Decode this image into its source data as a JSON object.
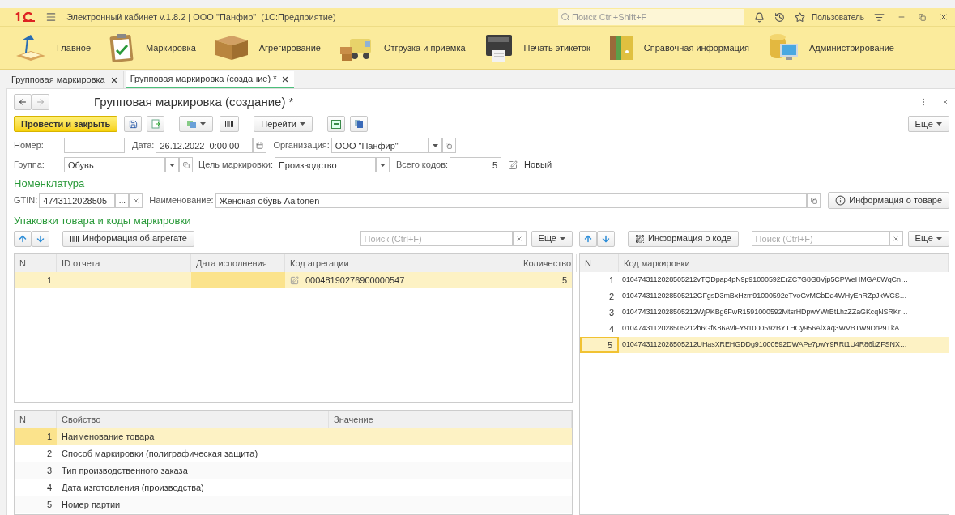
{
  "window": {
    "title": "Электронный кабинет v.1.8.2 | ООО \"Панфир\"  (1С:Предприятие)",
    "search_placeholder": "Поиск Ctrl+Shift+F",
    "user": "Пользователь"
  },
  "sections": [
    {
      "label": "Главное",
      "kind": "lamp"
    },
    {
      "label": "Маркировка",
      "kind": "clipboard"
    },
    {
      "label": "Агрегирование",
      "kind": "box"
    },
    {
      "label": "Отгрузка и приёмка",
      "kind": "truck"
    },
    {
      "label": "Печать этикеток",
      "kind": "printer"
    },
    {
      "label": "Справочная информация",
      "kind": "folders"
    },
    {
      "label": "Администрирование",
      "kind": "database"
    }
  ],
  "tabs": [
    {
      "label": "Групповая маркировка",
      "selected": false
    },
    {
      "label": "Групповая маркировка (создание) *",
      "selected": true
    }
  ],
  "form": {
    "title": "Групповая маркировка (создание) *",
    "post_button": "Провести и закрыть",
    "goto_button": "Перейти",
    "more_button": "Еще",
    "number": {
      "label": "Номер:"
    },
    "date": {
      "label": "Дата:",
      "value": "26.12.2022  0:00:00"
    },
    "organization": {
      "label": "Организация:",
      "value": "ООО \"Панфир\""
    },
    "group": {
      "label": "Группа:",
      "value": "Обувь"
    },
    "purpose": {
      "label": "Цель маркировки:",
      "value": "Производство"
    },
    "total": {
      "label": "Всего кодов:",
      "value": "5"
    },
    "status": "Новый"
  },
  "nomenclature": {
    "heading": "Номенклатура",
    "gtin_label": "GTIN:",
    "gtin": "4743112028505",
    "select_button": "...",
    "name_label": "Наименование:",
    "name": "Женская обувь Aaltonen",
    "info_button": "Информация о товаре"
  },
  "packages": {
    "heading": "Упаковки товара и коды маркировки",
    "aggregates": {
      "info_button": "Информация об агрегате",
      "search_placeholder": "Поиск (Ctrl+F)",
      "more_button": "Еще",
      "columns": [
        "N",
        "ID отчета",
        "Дата исполнения",
        "Код агрегации",
        "Количество"
      ],
      "rows": [
        {
          "n": "1",
          "code": "00048190276900000547",
          "quantity": "5",
          "selected": true
        }
      ]
    },
    "properties": {
      "columns": [
        "N",
        "Свойство",
        "Значение"
      ],
      "rows": [
        {
          "n": "1",
          "name": "Наименование товара",
          "selected": true
        },
        {
          "n": "2",
          "name": "Способ маркировки (полиграфическая защита)",
          "selected": false
        },
        {
          "n": "3",
          "name": "Тип производственного заказа",
          "selected": false
        },
        {
          "n": "4",
          "name": "Дата изготовления (производства)",
          "selected": false
        },
        {
          "n": "5",
          "name": "Номер партии",
          "selected": false
        }
      ]
    },
    "codes": {
      "info_button": "Информация о коде",
      "search_placeholder": "Поиск (Ctrl+F)",
      "more_button": "Еще",
      "columns": [
        "N",
        "Код маркировки"
      ],
      "rows": [
        {
          "n": "1",
          "code": "0104743112028505212vTQDpap4pN9p91000592ErZC7G8G8Vjp5CPWeHMGA8WqCn…",
          "selected": false
        },
        {
          "n": "2",
          "code": "0104743112028505212GFgsD3mBxHzm91000592eTvoGvMCbDq4WHyEhRZpJkWCS…",
          "selected": false
        },
        {
          "n": "3",
          "code": "0104743112028505212WjPKBg6FwR1591000592MtsrHDpwYWrBtLhzZZaGKcqNSRKr…",
          "selected": false
        },
        {
          "n": "4",
          "code": "0104743112028505212b6GfK86AviFY91000592BYTHCy956AiXaq3WVBTW9DrP9TkA…",
          "selected": false
        },
        {
          "n": "5",
          "code": "0104743112028505212UHasXREHGDDg91000592DWAPe7pwY9RRt1U4R86bZFSNX…",
          "selected": true
        }
      ]
    }
  }
}
